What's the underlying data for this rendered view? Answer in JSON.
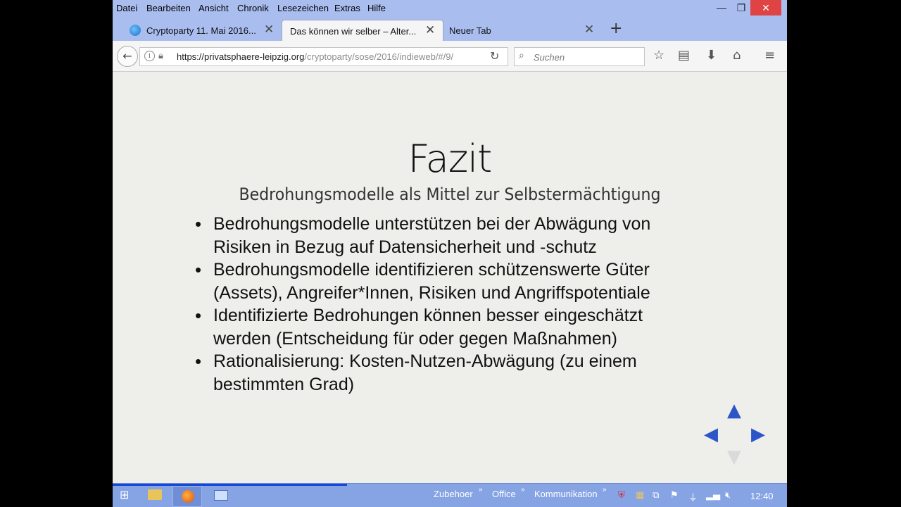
{
  "menubar": {
    "items": [
      "Datei",
      "Bearbeiten",
      "Ansicht",
      "Chronik",
      "Lesezeichen",
      "Extras",
      "Hilfe"
    ]
  },
  "window_controls": {
    "minimize": "—",
    "restore": "❐",
    "close": "✕"
  },
  "tabs": [
    {
      "title": "Cryptoparty 11. Mai 2016...",
      "icon": "globe-icon",
      "active": false
    },
    {
      "title": "Das können wir selber – Alter...",
      "active": true
    },
    {
      "title": "Neuer Tab",
      "active": false
    }
  ],
  "navbar": {
    "url_host": "https://privatsphaere-leipzig.org",
    "url_path": "/cryptoparty/sose/2016/indieweb/#/9/",
    "search_placeholder": "Suchen"
  },
  "slide": {
    "title": "Fazit",
    "subtitle": "Bedrohungsmodelle als Mittel zur Selbstermächtigung",
    "bullets": [
      "Bedrohungsmodelle unterstützen bei der Abwägung von Risiken in Bezug auf Datensicherheit und -schutz",
      "Bedrohungsmodelle identifizieren schützenswerte Güter (Assets), Angreifer*Innen, Risiken und Angriffspotentiale",
      "Identifizierte Bedrohungen können besser eingeschätzt werden (Entscheidung für oder gegen Maßnahmen)",
      "Rationalisierung: Kosten-Nutzen-Abwägung (zu einem bestimmten Grad)"
    ]
  },
  "taskbar": {
    "groups": [
      "Zubehoer",
      "Office",
      "Kommunikation"
    ],
    "clock": "12:40"
  },
  "colors": {
    "menubar": "#a9bdef",
    "taskbar": "#86a4e4",
    "close": "#e04343",
    "slide_bg": "#eeeeea",
    "nav_arrow": "#2c55c8"
  }
}
